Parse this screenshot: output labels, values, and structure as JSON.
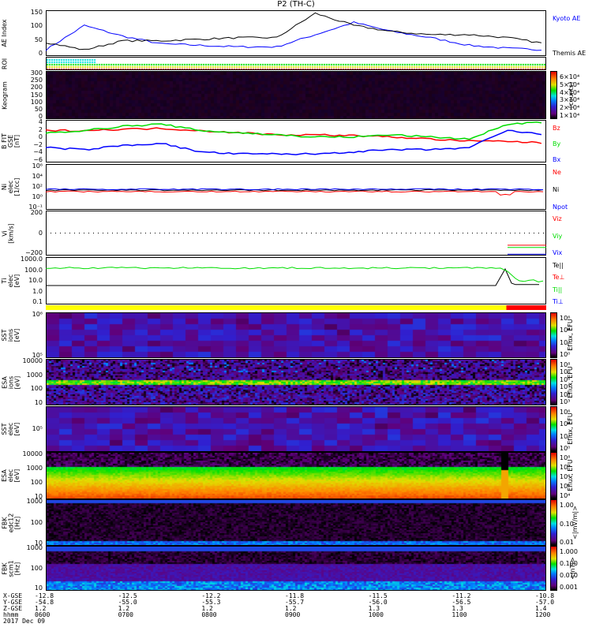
{
  "title": "P2 (TH-C)",
  "colors": {
    "red": "#ff0000",
    "green": "#00dd00",
    "blue": "#0000ff",
    "black": "#000000",
    "yellow": "#ffff00"
  },
  "chart_data": [
    {
      "type": "line",
      "panel": "ae",
      "ylabel": "AE Index",
      "ylim": [
        0,
        150
      ],
      "ticks": [
        "150",
        "100",
        "50",
        "0"
      ],
      "x": [
        "0600",
        "0630",
        "0700",
        "0730",
        "0800",
        "0830",
        "0900",
        "0930",
        "0945",
        "1000",
        "1030",
        "1100",
        "1130",
        "1200"
      ],
      "series": [
        {
          "name": "Kyoto AE",
          "color": "#0000ff",
          "values": [
            20,
            100,
            65,
            40,
            35,
            30,
            30,
            70,
            110,
            80,
            60,
            35,
            25,
            20
          ]
        },
        {
          "name": "Themis AE",
          "color": "#000000",
          "values": [
            45,
            20,
            50,
            50,
            55,
            60,
            60,
            140,
            100,
            80,
            70,
            70,
            60,
            40
          ]
        }
      ]
    },
    {
      "type": "heatmap",
      "panel": "roi",
      "ylabel": "ROI",
      "ticks": []
    },
    {
      "type": "heatmap",
      "panel": "keogram",
      "ylabel": "Keogram",
      "ticks": [
        "300",
        "250",
        "200",
        "150",
        "100",
        "50",
        "0"
      ],
      "colorbar": {
        "ticks": [
          "6×10⁴",
          "5×10⁴",
          "4×10⁴",
          "3×10⁴",
          "2×10⁴",
          "1×10⁴"
        ],
        "unit": "[counts]"
      }
    },
    {
      "type": "line",
      "panel": "bfit",
      "ylabel": "B FIT\nGSE\n[nT]",
      "ylim": [
        -6,
        4
      ],
      "ticks": [
        "4",
        "2",
        "0",
        "−2",
        "−4",
        "−6"
      ],
      "x": [
        "0600",
        "0630",
        "0700",
        "0730",
        "0800",
        "0830",
        "0900",
        "0930",
        "1000",
        "1030",
        "1100",
        "1130",
        "1145",
        "1200"
      ],
      "series": [
        {
          "name": "Bz",
          "color": "#ff0000",
          "values": [
            1.5,
            1.5,
            1.8,
            2,
            1.5,
            1,
            0.5,
            0.5,
            0.3,
            0,
            -0.5,
            -1,
            -1,
            -1.5
          ]
        },
        {
          "name": "By",
          "color": "#00dd00",
          "values": [
            1,
            1.5,
            2.5,
            3,
            1.5,
            1,
            0.5,
            0,
            0,
            0.5,
            0,
            -0.5,
            3,
            3.5
          ]
        },
        {
          "name": "Bx",
          "color": "#0000ff",
          "values": [
            -2.5,
            -3,
            -2,
            -1.5,
            -3.5,
            -4,
            -4,
            -4,
            -3.5,
            -3,
            -3,
            -2.5,
            1.5,
            0.5
          ]
        }
      ]
    },
    {
      "type": "line",
      "panel": "ni",
      "ylabel": "Ni\nelec\n[1/cc]",
      "ylim": [
        -1,
        6
      ],
      "ticks": [
        "10⁶",
        "10⁴",
        "10²",
        "10⁰",
        "10⁻¹"
      ],
      "series": [
        {
          "name": "Ne",
          "color": "#ff0000"
        },
        {
          "name": "Ni",
          "color": "#000000"
        },
        {
          "name": "Npot",
          "color": "#0000ff"
        }
      ]
    },
    {
      "type": "line",
      "panel": "vi",
      "ylabel": "Vi\n[km/s]",
      "ylim": [
        -300,
        300
      ],
      "ticks": [
        "200",
        "0",
        "−200"
      ],
      "series": [
        {
          "name": "Viz",
          "color": "#ff0000"
        },
        {
          "name": "Viy",
          "color": "#00dd00"
        },
        {
          "name": "Vix",
          "color": "#0000ff"
        }
      ]
    },
    {
      "type": "line",
      "panel": "ti",
      "ylabel": "Ti\nelec\n[eV]",
      "ticks": [
        "1000.0",
        "100.0",
        "10.0",
        "1.0",
        "0.1"
      ],
      "series": [
        {
          "name": "Te||",
          "color": "#000000"
        },
        {
          "name": "Te⊥",
          "color": "#ff0000"
        },
        {
          "name": "Ti||",
          "color": "#00dd00"
        },
        {
          "name": "Ti⊥",
          "color": "#0000ff"
        }
      ]
    },
    {
      "type": "heatmap",
      "panel": "sst-ions",
      "ylabel": "SST\nions\n[eV]",
      "ticks": [
        "10⁶",
        "10⁵"
      ],
      "colorbar": {
        "ticks": [
          "10⁶",
          "10⁴",
          "10²",
          "10⁰"
        ],
        "unit": "Eflux, EFU"
      }
    },
    {
      "type": "heatmap",
      "panel": "esa-ions",
      "ylabel": "ESA\nions\n[eV]",
      "ticks": [
        "10000",
        "1000",
        "100",
        "10"
      ],
      "colorbar": {
        "ticks": [
          "10⁸",
          "10⁷",
          "10⁶",
          "10⁵",
          "10⁴",
          "10³"
        ],
        "unit": "Eflux, EFU"
      }
    },
    {
      "type": "heatmap",
      "panel": "sst-elec",
      "ylabel": "SST\nelec\n[eV]",
      "ticks": [
        "10⁵"
      ],
      "colorbar": {
        "ticks": [
          "10⁶",
          "10⁴",
          "10²",
          "10⁰"
        ],
        "unit": "Eflux, EFU"
      }
    },
    {
      "type": "heatmap",
      "panel": "esa-elec",
      "ylabel": "ESA\nelec\n[eV]",
      "ticks": [
        "10000",
        "1000",
        "100",
        "10"
      ],
      "colorbar": {
        "ticks": [
          "10⁸",
          "10⁷",
          "10⁶",
          "10⁵",
          "10⁴"
        ],
        "unit": "Eflux, EFU"
      }
    },
    {
      "type": "heatmap",
      "panel": "fbk-edc12",
      "ylabel": "FBK\nedc12\n[Hz]",
      "ticks": [
        "1000",
        "100",
        "10"
      ],
      "colorbar": {
        "ticks": [
          "1.00",
          "0.10",
          "0.01"
        ],
        "unit": "<|mV/m|>"
      }
    },
    {
      "type": "heatmap",
      "panel": "fbk-scm1",
      "ylabel": "FBK\nscm1\n[Hz]",
      "ticks": [
        "1000",
        "100",
        "10"
      ],
      "colorbar": {
        "ticks": [
          "1.000",
          "0.100",
          "0.010",
          "0.001"
        ],
        "unit": "<|nT|>"
      }
    }
  ],
  "footer": {
    "rows": [
      {
        "label": "X-GSE",
        "values": [
          "-12.8",
          "-12.5",
          "-12.2",
          "-11.8",
          "-11.5",
          "-11.2",
          "-10.8"
        ]
      },
      {
        "label": "Y-GSE",
        "values": [
          "-54.8",
          "-55.0",
          "-55.3",
          "-55.7",
          "-56.0",
          "-56.5",
          "-57.0"
        ]
      },
      {
        "label": "Z-GSE",
        "values": [
          "1.2",
          "1.2",
          "1.2",
          "1.2",
          "1.3",
          "1.3",
          "1.4"
        ]
      },
      {
        "label": "hhmm",
        "values": [
          "0600",
          "0700",
          "0800",
          "0900",
          "1000",
          "1100",
          "1200"
        ]
      }
    ],
    "date": "2017 Dec 09"
  }
}
